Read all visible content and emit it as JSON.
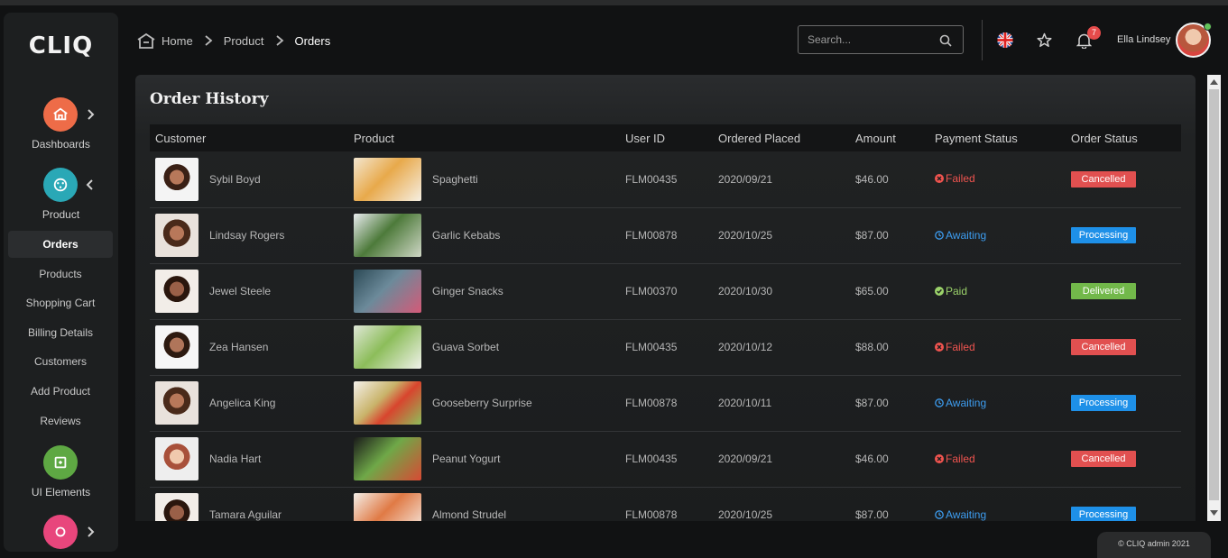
{
  "brand": {
    "logo": "CLIQ"
  },
  "sidebar": {
    "groups": [
      {
        "label": "Dashboards",
        "icon": "home-icon",
        "color": "#ee6c48"
      },
      {
        "label": "Product",
        "icon": "product-icon",
        "color": "#2aa8b6"
      },
      {
        "label": "UI Elements",
        "icon": "ui-elements-icon",
        "color": "#5ea843"
      },
      {
        "label": "",
        "icon": "apps-icon",
        "color": "#e8467c"
      }
    ],
    "submenu": [
      "Orders",
      "Products",
      "Shopping Cart",
      "Billing Details",
      "Customers",
      "Add Product",
      "Reviews"
    ]
  },
  "header": {
    "breadcrumb": [
      "Home",
      "Product",
      "Orders"
    ],
    "search_placeholder": "Search...",
    "notification_count": "7",
    "user_name": "Ella Lindsey"
  },
  "orders": {
    "title": "Order History",
    "columns": [
      "Customer",
      "Product",
      "User ID",
      "Ordered Placed",
      "Amount",
      "Payment Status",
      "Order Status"
    ],
    "rows": [
      {
        "customer": "Sybil Boyd",
        "product": "Spaghetti",
        "user_id": "FLM00435",
        "date": "2020/09/21",
        "amount": "$46.00",
        "payment": "Failed",
        "status": "Cancelled"
      },
      {
        "customer": "Lindsay Rogers",
        "product": "Garlic Kebabs",
        "user_id": "FLM00878",
        "date": "2020/10/25",
        "amount": "$87.00",
        "payment": "Awaiting",
        "status": "Processing"
      },
      {
        "customer": "Jewel Steele",
        "product": "Ginger Snacks",
        "user_id": "FLM00370",
        "date": "2020/10/30",
        "amount": "$65.00",
        "payment": "Paid",
        "status": "Delivered"
      },
      {
        "customer": "Zea Hansen",
        "product": "Guava Sorbet",
        "user_id": "FLM00435",
        "date": "2020/10/12",
        "amount": "$88.00",
        "payment": "Failed",
        "status": "Cancelled"
      },
      {
        "customer": "Angelica King",
        "product": "Gooseberry Surprise",
        "user_id": "FLM00878",
        "date": "2020/10/11",
        "amount": "$87.00",
        "payment": "Awaiting",
        "status": "Processing"
      },
      {
        "customer": "Nadia Hart",
        "product": "Peanut Yogurt",
        "user_id": "FLM00435",
        "date": "2020/09/21",
        "amount": "$46.00",
        "payment": "Failed",
        "status": "Cancelled"
      },
      {
        "customer": "Tamara Aguilar",
        "product": "Almond Strudel",
        "user_id": "FLM00878",
        "date": "2020/10/25",
        "amount": "$87.00",
        "payment": "Awaiting",
        "status": "Processing"
      }
    ]
  },
  "colors": {
    "failed": "#f0544f",
    "awaiting": "#3d9df0",
    "paid": "#9bd26a",
    "cancelled": "#e15050",
    "processing": "#1e90e8",
    "delivered": "#72b84a"
  },
  "footer": {
    "text": "© CLIQ admin 2021"
  }
}
